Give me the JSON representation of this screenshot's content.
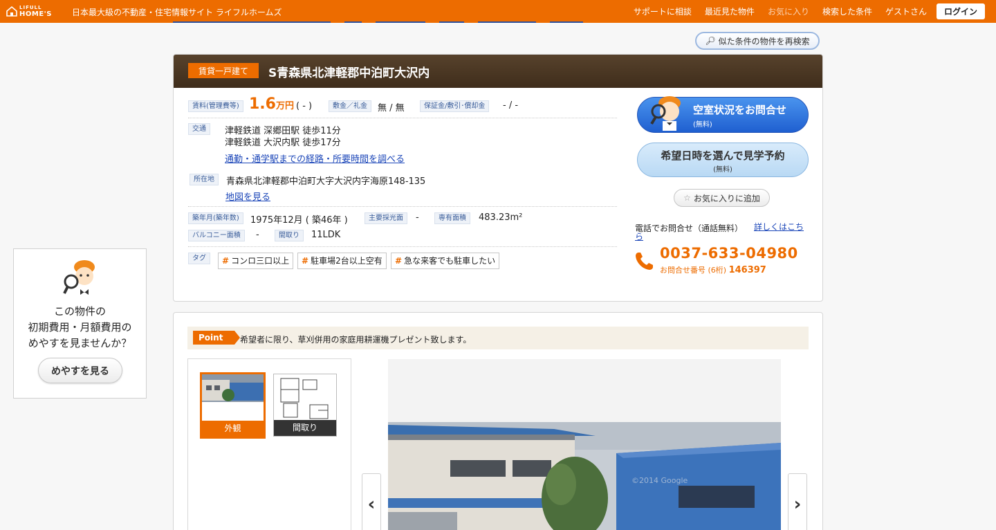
{
  "header": {
    "logo_top": "LIFULL",
    "logo_main": "HOME'S",
    "site_description": "日本最大級の不動産・住宅情報サイト ライフルホームズ",
    "nav": [
      "サポートに相談",
      "最近見た物件",
      "お気に入り",
      "検索した条件",
      "ゲストさん"
    ],
    "login": "ログイン"
  },
  "research_button": "似た条件の物件を再検索",
  "property": {
    "type_badge": "賃貸一戸建て",
    "title": "S青森県北津軽郡中泊町大沢内",
    "rent_label": "賃料(管理費等)",
    "rent_value": "1.6",
    "rent_unit": "万円",
    "rent_note": "( - )",
    "deposit_label": "敷金／礼金",
    "deposit_value": "無 / 無",
    "guarantee_label": "保証金/敷引･償却金",
    "guarantee_value": "- / -",
    "access_label": "交通",
    "access_lines": [
      "津軽鉄道 深郷田駅 徒歩11分",
      "津軽鉄道 大沢内駅 徒歩17分"
    ],
    "route_link": "通勤・通学駅までの経路・所要時間を調べる",
    "address_label": "所在地",
    "address_value": "青森県北津軽郡中泊町大字大沢内字海原148-135",
    "map_link": "地図を見る",
    "built_label": "築年月(築年数)",
    "built_value": "1975年12月 ( 築46年 )",
    "lighting_label": "主要採光面",
    "lighting_value": "-",
    "area_label": "専有面積",
    "area_value": "483.23m²",
    "balcony_label": "バルコニー面積",
    "balcony_value": "-",
    "layout_label": "間取り",
    "layout_value": "11LDK",
    "tags_label": "タグ",
    "tags": [
      "コンロ三口以上",
      "駐車場2台以上空有",
      "急な来客でも駐車したい"
    ]
  },
  "actions": {
    "inquiry_title": "空室状況をお問合せ",
    "inquiry_sub": "(無料)",
    "visit_title": "希望日時を選んで見学予約",
    "visit_sub": "(無料)",
    "favorite": "お気に入りに追加",
    "phone_label": "電話でお問合せ（通話無料）",
    "phone_detail_link": "詳しくはこちら",
    "phone_number": "0037-633-04980",
    "inquiry_number_label": "お問合せ番号 (6桁)",
    "inquiry_number": "146397"
  },
  "side_widget": {
    "lines": [
      "この物件の",
      "初期費用・月額費用の",
      "めやすを見ませんか？"
    ],
    "button": "めやすを見る"
  },
  "point": {
    "tag": "Point",
    "text": "希望者に限り、草刈併用の家庭用耕運機プレゼント致します。"
  },
  "gallery": {
    "thumbs": [
      "外観",
      "間取り"
    ],
    "prev": "‹",
    "next": "›",
    "watermark": "©2014 Google"
  },
  "colors": {
    "brand_orange": "#ed6c00",
    "header_brown": "#4a3723",
    "link_blue": "#1a45b8"
  }
}
